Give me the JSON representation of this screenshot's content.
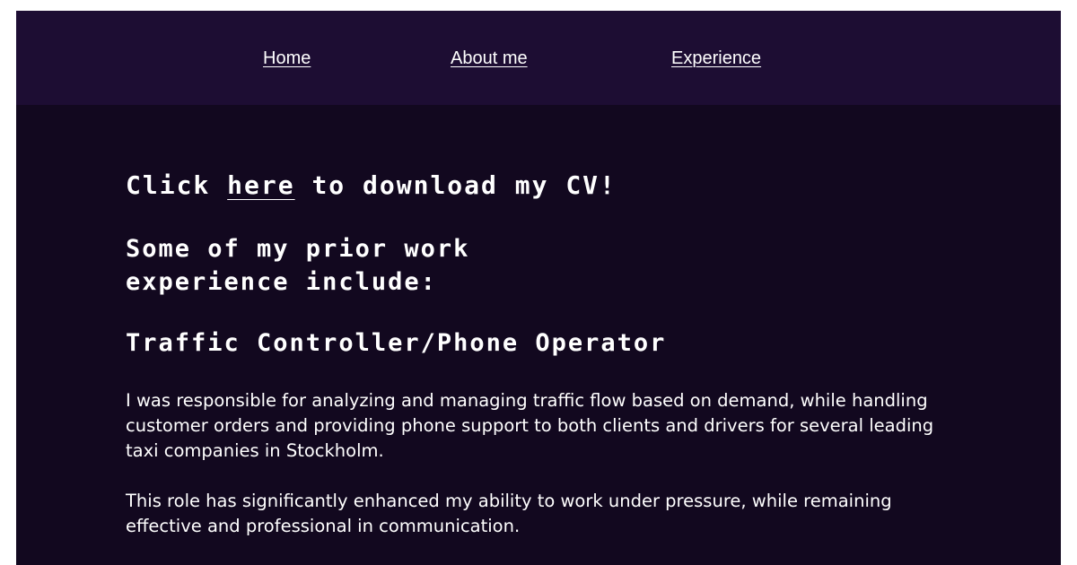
{
  "nav": {
    "home": "Home",
    "about": "About me",
    "experience": "Experience"
  },
  "cv": {
    "prefix": "Click ",
    "link": "here",
    "suffix": " to download my CV!"
  },
  "intro_heading": "Some of my prior work experience include:",
  "job": {
    "title": "Traffic Controller/Phone Operator",
    "paragraph1": "I was responsible for analyzing and managing traffic flow based on demand, while handling customer orders and providing phone support to both clients and drivers for several leading taxi companies in Stockholm.",
    "paragraph2": "This role has significantly enhanced my ability to work under pressure, while remaining effective and professional in communication."
  },
  "colors": {
    "background": "#12081f",
    "navbar": "#1d0d33",
    "text": "#ffffff"
  }
}
